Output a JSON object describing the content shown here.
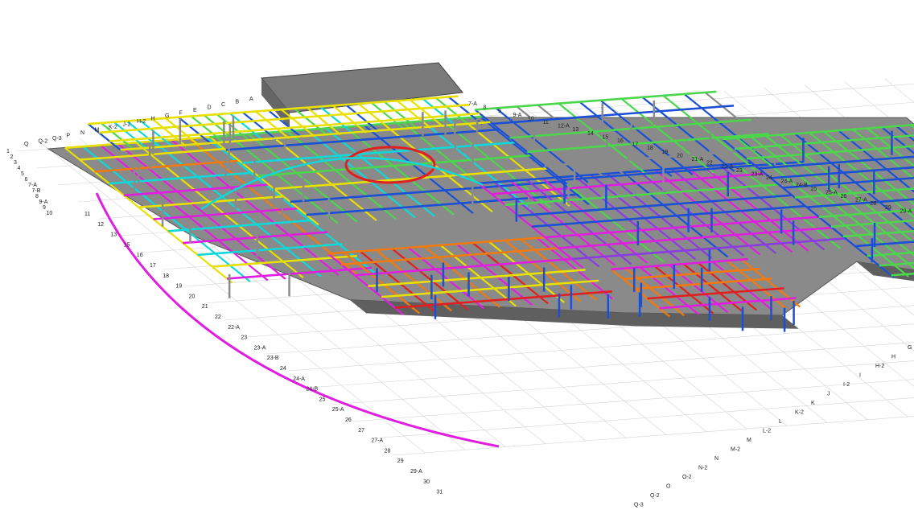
{
  "viewport": {
    "label": "3D structural model view"
  },
  "grid_labels": {
    "front_numeric": [
      "11",
      "12",
      "13",
      "15",
      "16",
      "17",
      "18",
      "19",
      "20",
      "21",
      "22",
      "22-A",
      "23",
      "23-A",
      "23-B",
      "24",
      "24-A",
      "24-B",
      "25",
      "25-A",
      "26",
      "27",
      "27-A",
      "28",
      "29",
      "29-A",
      "30",
      "31"
    ],
    "left_numeric": [
      "1",
      "2",
      "3",
      "4",
      "5",
      "6",
      "7-A",
      "7-B",
      "8",
      "9-A",
      "9",
      "10"
    ],
    "right_letters": [
      "G",
      "H",
      "H-2",
      "I",
      "I-2",
      "J",
      "K",
      "K-2",
      "L",
      "L-2",
      "M",
      "M-2",
      "N",
      "N-2",
      "O-2",
      "O",
      "Q-2",
      "Q-3"
    ],
    "back_numeric": [
      "7-A",
      "8",
      "9",
      "9-A",
      "10",
      "11",
      "12-A",
      "13",
      "14",
      "15",
      "16",
      "17",
      "18",
      "19",
      "20",
      "21-A",
      "22",
      "22-A",
      "23",
      "23-A",
      "24",
      "24-A",
      "24-B",
      "25",
      "25-A",
      "26",
      "27-A",
      "28",
      "29",
      "29-A"
    ],
    "back_letters": [
      "Q",
      "Q-2",
      "Q-3",
      "P",
      "N",
      "M",
      "K-2",
      "J-2",
      "H-2",
      "H",
      "G",
      "F",
      "E",
      "D",
      "C",
      "B",
      "A"
    ]
  },
  "member_colors": {
    "structure_gray": "#8a8a8a",
    "slab_dark": "#5f5f5f",
    "beam_green": "#4cd64c",
    "beam_blue": "#1a4fd6",
    "beam_magenta": "#e01ee0",
    "beam_yellow": "#e8e000",
    "beam_orange": "#f07a10",
    "beam_red": "#e02020",
    "beam_cyan": "#10d8d8",
    "beam_purple": "#8a3ce0"
  }
}
